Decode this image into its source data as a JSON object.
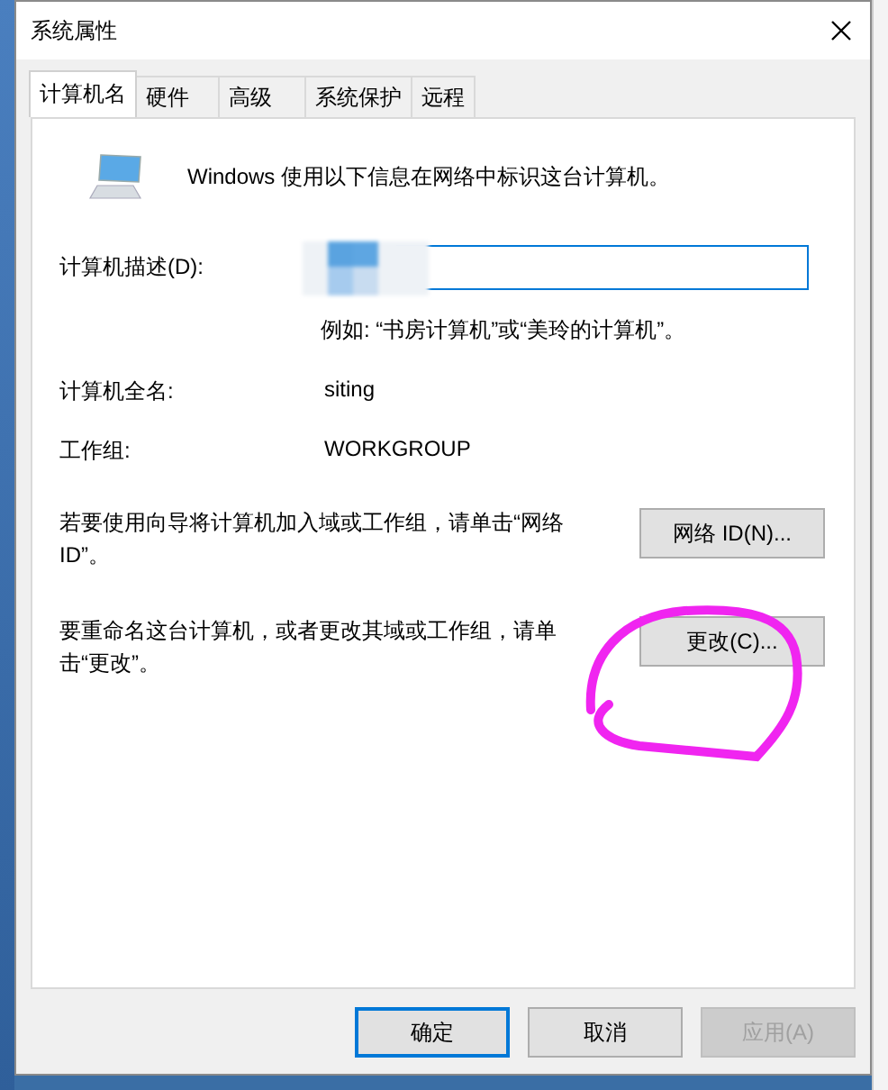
{
  "window": {
    "title": "系统属性"
  },
  "tabs": [
    {
      "label": "计算机名",
      "selected": true
    },
    {
      "label": "硬件",
      "selected": false
    },
    {
      "label": "高级",
      "selected": false
    },
    {
      "label": "系统保护",
      "selected": false
    },
    {
      "label": "远程",
      "selected": false
    }
  ],
  "intro": "Windows 使用以下信息在网络中标识这台计算机。",
  "description": {
    "label": "计算机描述(D):",
    "focused": true,
    "hint": "例如: “书房计算机”或“美玲的计算机”。"
  },
  "full_name": {
    "label": "计算机全名:",
    "value": "siting"
  },
  "workgroup": {
    "label": "工作组:",
    "value": "WORKGROUP"
  },
  "actions": [
    {
      "text": "若要使用向导将计算机加入域或工作组，请单击“网络 ID”。",
      "button": "网络 ID(N)..."
    },
    {
      "text": "要重命名这台计算机，或者更改其域或工作组，请单击“更改”。",
      "button": "更改(C)..."
    }
  ],
  "buttons": [
    {
      "label": "确定",
      "kind": "default",
      "disabled": false
    },
    {
      "label": "取消",
      "kind": "normal",
      "disabled": false
    },
    {
      "label": "应用(A)",
      "kind": "normal",
      "disabled": true
    }
  ]
}
